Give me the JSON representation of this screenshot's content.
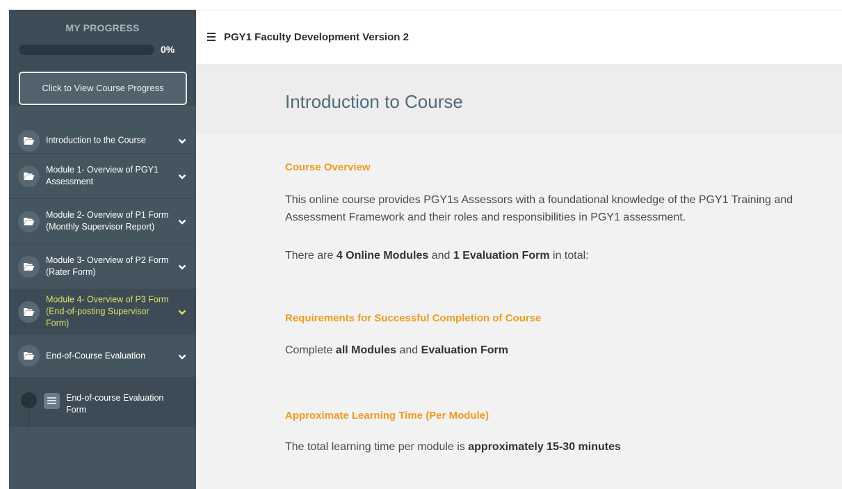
{
  "sidebar": {
    "progress_title": "MY PROGRESS",
    "progress_percent": "0%",
    "progress_value": 0,
    "view_progress_label": "Click to View Course Progress",
    "modules": [
      {
        "label": "Introduction to the Course"
      },
      {
        "label": "Module 1- Overview of PGY1 Assessment"
      },
      {
        "label": "Module 2- Overview of P1 Form (Monthly Supervisor Report)"
      },
      {
        "label": "Module 3- Overview of P2 Form (Rater Form)"
      },
      {
        "label": "Module 4- Overview of P3 Form (End-of-posting Supervisor Form)"
      },
      {
        "label": "End-of-Course Evaluation"
      }
    ],
    "subitem": {
      "label": "End-of-course Evaluation Form"
    }
  },
  "header": {
    "course_title": "PGY1 Faculty Development Version 2"
  },
  "main": {
    "page_title": "Introduction to Course",
    "overview_heading": "Course Overview",
    "overview_text": "This online course provides PGY1s Assessors with a foundational knowledge of the PGY1 Training and Assessment Framework and their roles and responsibilities in PGY1 assessment.",
    "modules_line": {
      "prefix": "There are ",
      "modules_count": "4 Online Modules",
      "and": " and ",
      "eval_count": "1 Evaluation Form",
      "suffix": " in total:"
    },
    "requirements_heading": "Requirements for Successful Completion of Course",
    "requirements_line": {
      "prefix": "Complete ",
      "modules": "all Modules",
      "and": " and ",
      "eval": "Evaluation Form"
    },
    "time_heading": "Approximate Learning Time (Per Module)",
    "time_line": {
      "prefix": "The total learning time per module is ",
      "value": "approximately 15-30 minutes"
    }
  },
  "colors": {
    "sidebar_bg": "#45555f",
    "accent_orange": "#f29a1f",
    "active_module_text": "#dbe46a",
    "title_blue": "#4e6b7b"
  },
  "icons": {
    "module": "folder-open-icon",
    "expand": "chevron-down-icon",
    "menu": "hamburger-icon",
    "form": "list-icon"
  }
}
